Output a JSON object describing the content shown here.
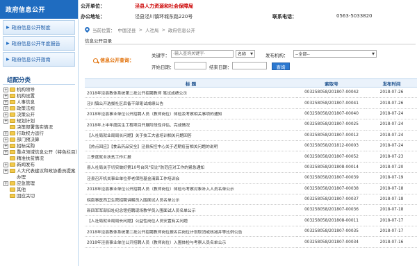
{
  "sidebar": {
    "header": "政府信息公开",
    "links": [
      {
        "label": "政府信息公开制度"
      },
      {
        "label": "政府信息公开年度报告"
      },
      {
        "label": "政府信息公开指南"
      }
    ],
    "category_title": "组配分类",
    "tree": [
      {
        "label": "机构领导",
        "expandable": true
      },
      {
        "label": "机构设置",
        "expandable": true
      },
      {
        "label": "人事信息",
        "expandable": true
      },
      {
        "label": "政策法规",
        "expandable": true
      },
      {
        "label": "决策公开",
        "expandable": true
      },
      {
        "label": "规划计划",
        "expandable": true
      },
      {
        "label": "决策部署落实情况",
        "expandable": false
      },
      {
        "label": "行政权力运行",
        "expandable": true
      },
      {
        "label": "部门预决算",
        "expandable": true
      },
      {
        "label": "招标采购",
        "expandable": true
      },
      {
        "label": "重点领域信息公开（特色栏目）",
        "expandable": true
      },
      {
        "label": "精准扶贫情况",
        "expandable": false
      },
      {
        "label": "新闻发布",
        "expandable": true
      },
      {
        "label": "人大代表建议和政协委员提案办理",
        "expandable": true
      },
      {
        "label": "应急管理",
        "expandable": true
      },
      {
        "label": "其他",
        "expandable": false
      },
      {
        "label": "回应关切",
        "expandable": false
      }
    ]
  },
  "header": {
    "unit_label": "公开单位：",
    "unit_value": "泾县人力资源和社会保障局",
    "address_label": "办公地址：",
    "address_value": "泾县泾川镇环城东路220号",
    "phone_label": "联系电话：",
    "phone_value": "0563-5033820"
  },
  "breadcrumb": {
    "prefix": "当前位置：",
    "items": [
      "中国泾县",
      "人社局",
      "政府信息公开"
    ],
    "separator": ">"
  },
  "list_title": "信息公开目录",
  "search": {
    "label": "信息公开查询：",
    "keyword_label": "关键字：",
    "keyword_placeholder": "-输入查询关键字-",
    "field_select": "名称",
    "org_label": "发布机构：",
    "org_select": "--全部--",
    "start_label": "开始日期：",
    "end_label": "结束日期：",
    "button": "查询"
  },
  "table": {
    "headers": [
      "标 题",
      "索取号",
      "发布时间"
    ],
    "rows": [
      {
        "title": "2018年泾县教体系统第二批公开招聘教师 笔试成绩公示",
        "index": "003258058/201807-00042",
        "date": "2018-07-26"
      },
      {
        "title": "泾川镇公开选拔社区后备干部笔试成绩公告",
        "index": "003258058/201807-00041",
        "date": "2018-07-26"
      },
      {
        "title": "2018年泾县事业单位公开招聘人员（教师岗位）体检及考察相关事项的通知",
        "index": "003258058/201807-00040",
        "date": "2018-07-24"
      },
      {
        "title": "2018年上半年度民生工程项目开展阶段性评估、完成情况",
        "index": "003258058/201807-00025",
        "date": "2018-07-24"
      },
      {
        "title": "【人社局就业局局长问题】关于技工大省培训相关问题回答",
        "index": "003258058/201807-00012",
        "date": "2018-07-24"
      },
      {
        "title": "【热点回应】【食品药品安全】泾县疾控中心关于近期疫苗相关问题的说明",
        "index": "003258058/201812-00003",
        "date": "2018-07-24"
      },
      {
        "title": "二季度就业扶贫工作汇报",
        "index": "003258058/201807-00052",
        "date": "2018-07-23"
      },
      {
        "title": "县人社局关于切实做好第10号台风\"安比\"防范应对工作的紧急通知",
        "index": "003258058/201808-00014",
        "date": "2018-07-20"
      },
      {
        "title": "泾县召开机关事业单位养老保险基金清算工作培训会",
        "index": "003258058/201807-00039",
        "date": "2018-07-19"
      },
      {
        "title": "2018年泾县事业单位公开招聘人员（教师岗位）体检与考察对象补入人员名单公示",
        "index": "003258058/201807-00038",
        "date": "2018-07-18"
      },
      {
        "title": "皖南事医西卫生院招聘讲解员入围面试人员名单公示",
        "index": "003258058/201807-00037",
        "date": "2018-07-18"
      },
      {
        "title": "新四军军部旧址纪念馆招聘现场教学员入围面试人员名单公示",
        "index": "003258058/201807-00036",
        "date": "2018-07-18"
      },
      {
        "title": "【人社局就业局局长问题】公益性岗位人员安置有关问题",
        "index": "003258058/201808-00011",
        "date": "2018-07-17"
      },
      {
        "title": "2018年泾县教体系统第二批公开招聘教师岗位报名后岗位计划取消或核减并等比例公告",
        "index": "003258058/201807-00035",
        "date": "2018-07-17"
      },
      {
        "title": "2018年泾县事业单位公开招聘人员（教师岗位）入围体检与考察人员名单公示",
        "index": "003258058/201807-00034",
        "date": "2018-07-16"
      }
    ]
  }
}
